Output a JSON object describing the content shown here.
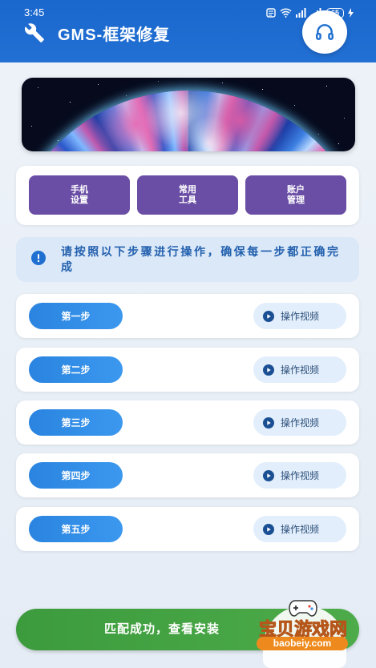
{
  "status_bar": {
    "time": "3:45",
    "battery": "65",
    "icons": [
      "notification-icon",
      "wifi-icon",
      "signal-icon",
      "signal-icon",
      "battery-icon",
      "charging-icon"
    ]
  },
  "app_bar": {
    "title": "GMS-框架修复",
    "left_icon": "wrench-icon",
    "right_icon": "headphones-icon"
  },
  "banner": {
    "image": "planet-image"
  },
  "tools": [
    {
      "label": "手机\n设置"
    },
    {
      "label": "常用\n工具"
    },
    {
      "label": "账户\n管理"
    }
  ],
  "notice": {
    "icon": "info-icon",
    "text": "请按照以下步骤进行操作，确保每一步都正确完成"
  },
  "steps": [
    {
      "label": "第一步",
      "video_label": "操作视频"
    },
    {
      "label": "第二步",
      "video_label": "操作视频"
    },
    {
      "label": "第三步",
      "video_label": "操作视频"
    },
    {
      "label": "第四步",
      "video_label": "操作视频"
    },
    {
      "label": "第五步",
      "video_label": "操作视频"
    }
  ],
  "action_button": {
    "label": "匹配成功，查看安装"
  },
  "watermark": {
    "title": "宝贝游戏网",
    "url": "baobeiy.com"
  },
  "colors": {
    "app_bar": "#1a67cd",
    "background": "#e8eef6",
    "tool_button": "#6a4ea5",
    "step_button": "#2a84e0",
    "video_button": "#e2eefb",
    "notice_bg": "#dae8f8",
    "notice_text": "#2461ae",
    "action_button": "#3c9b3d"
  }
}
